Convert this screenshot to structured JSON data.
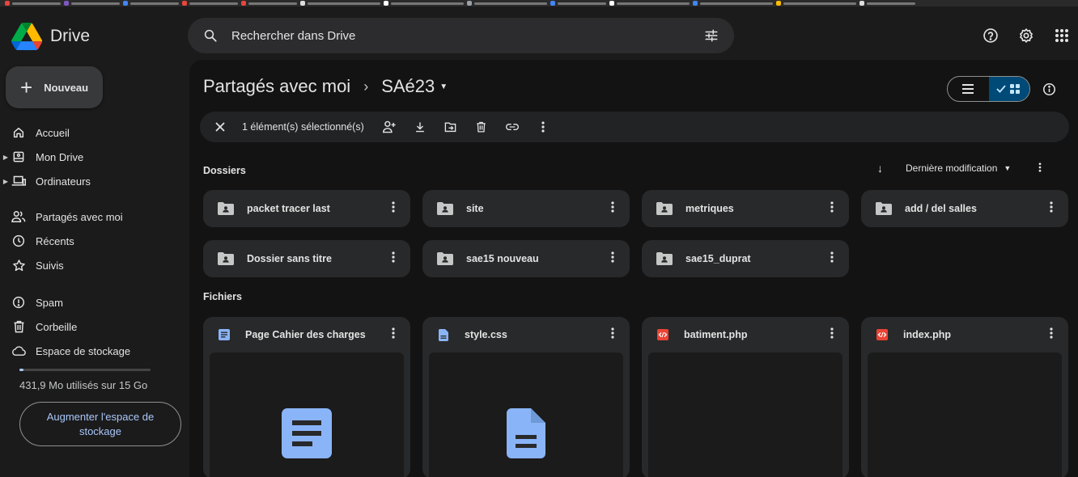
{
  "app": {
    "name": "Drive"
  },
  "search": {
    "placeholder": "Rechercher dans Drive"
  },
  "sidebar": {
    "new_label": "Nouveau",
    "items": [
      {
        "label": "Accueil",
        "icon": "home-icon"
      },
      {
        "label": "Mon Drive",
        "icon": "my-drive-icon"
      },
      {
        "label": "Ordinateurs",
        "icon": "computer-icon"
      },
      {
        "label": "Partagés avec moi",
        "icon": "people-icon"
      },
      {
        "label": "Récents",
        "icon": "clock-icon"
      },
      {
        "label": "Suivis",
        "icon": "star-icon"
      },
      {
        "label": "Spam",
        "icon": "spam-icon"
      },
      {
        "label": "Corbeille",
        "icon": "trash-icon"
      },
      {
        "label": "Espace de stockage",
        "icon": "cloud-icon"
      }
    ],
    "storage_text": "431,9 Mo utilisés sur 15 Go",
    "storage_fraction": 0.03,
    "upgrade_label": "Augmenter l'espace de stockage"
  },
  "breadcrumb": {
    "parent": "Partagés avec moi",
    "current": "SAé23"
  },
  "selection": {
    "text": "1 élément(s) sélectionné(s)"
  },
  "sections": {
    "folders": "Dossiers",
    "files": "Fichiers"
  },
  "sort": {
    "label": "Dernière modification"
  },
  "folders": [
    {
      "name": "packet tracer last"
    },
    {
      "name": "site"
    },
    {
      "name": "metriques"
    },
    {
      "name": "add / del salles"
    },
    {
      "name": "Dossier sans titre"
    },
    {
      "name": "sae15 nouveau"
    },
    {
      "name": "sae15_duprat"
    }
  ],
  "files": [
    {
      "name": "Page Cahier des charges",
      "icon": "google-docs-icon",
      "color": "#8ab4f8"
    },
    {
      "name": "style.css",
      "icon": "document-icon",
      "color": "#8ab4f8"
    },
    {
      "name": "batiment.php",
      "icon": "code-file-icon",
      "color": "#ea4335"
    },
    {
      "name": "index.php",
      "icon": "code-file-icon",
      "color": "#ea4335"
    }
  ],
  "colors": {
    "accent": "#a8c7fa",
    "toggle_on": "#004a77",
    "panel": "#131314",
    "card": "#28292a"
  }
}
